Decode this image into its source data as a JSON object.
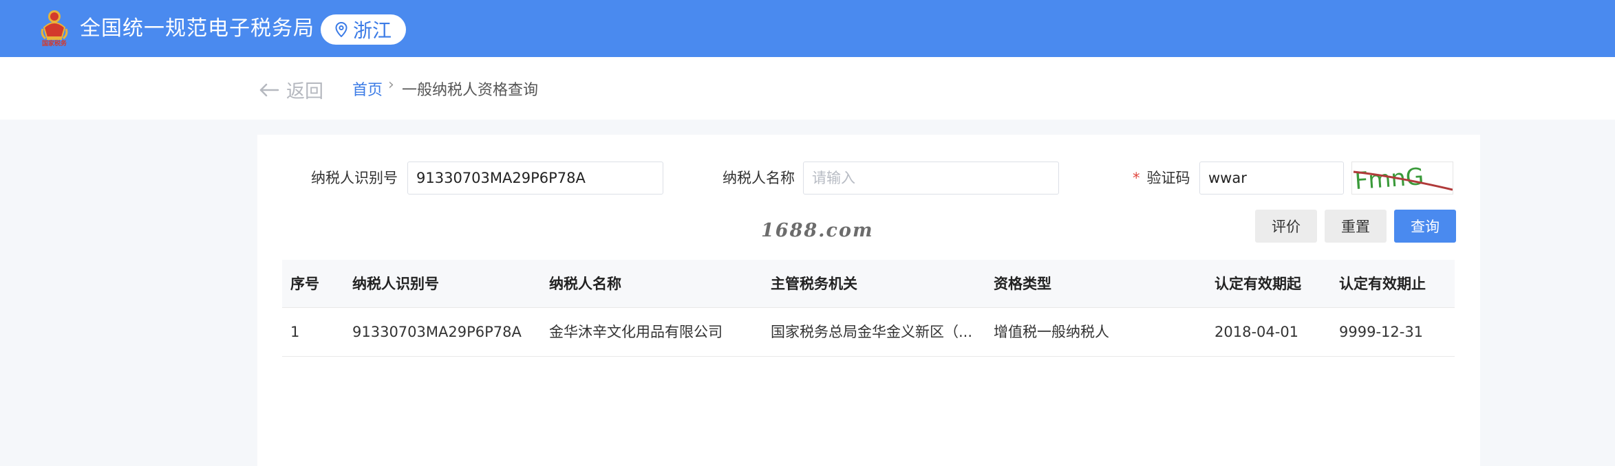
{
  "header": {
    "emblem_text": "国家税务",
    "site_title": "全国统一规范电子税务局",
    "region": "浙江"
  },
  "breadcrumb": {
    "back_label": "返回",
    "home": "首页",
    "separator": "›",
    "current": "一般纳税人资格查询"
  },
  "form": {
    "taxpayer_id_label": "纳税人识别号",
    "taxpayer_id_value": "91330703MA29P6P78A",
    "taxpayer_name_label": "纳税人名称",
    "taxpayer_name_placeholder": "请输入",
    "captcha_required_mark": "*",
    "captcha_label": "验证码",
    "captcha_value": "wwar",
    "captcha_image_text": "FmnG"
  },
  "buttons": {
    "evaluate": "评价",
    "reset": "重置",
    "query": "查询"
  },
  "watermark": "1688.com",
  "table": {
    "columns": [
      "序号",
      "纳税人识别号",
      "纳税人名称",
      "主管税务机关",
      "资格类型",
      "认定有效期起",
      "认定有效期止"
    ],
    "rows": [
      [
        "1",
        "91330703MA29P6P78A",
        "金华沐辛文化用品有限公司",
        "国家税务总局金华金义新区（...",
        "增值税一般纳税人",
        "2018-04-01",
        "9999-12-31"
      ]
    ]
  },
  "colors": {
    "brand_blue": "#4a8aef",
    "link_blue": "#3b7be6",
    "required_red": "#e0463d"
  },
  "icons": {
    "emblem": "tax-emblem-icon",
    "region": "location-pin-icon",
    "back": "arrow-left-icon"
  }
}
